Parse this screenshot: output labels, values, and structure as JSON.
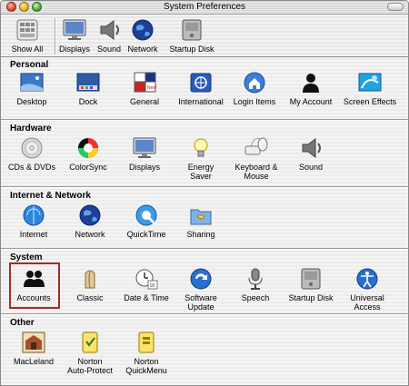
{
  "window": {
    "title": "System Preferences"
  },
  "toolbar": {
    "items": [
      {
        "label": "Show All",
        "icon": "show-all-icon"
      },
      {
        "label": "Displays",
        "icon": "display-icon"
      },
      {
        "label": "Sound",
        "icon": "speaker-icon"
      },
      {
        "label": "Network",
        "icon": "globe-icon"
      },
      {
        "label": "Startup Disk",
        "icon": "hard-disk-icon"
      }
    ]
  },
  "sections": [
    {
      "title": "Personal",
      "items": [
        {
          "label": "Desktop"
        },
        {
          "label": "Dock"
        },
        {
          "label": "General"
        },
        {
          "label": "International"
        },
        {
          "label": "Login Items"
        },
        {
          "label": "My Account"
        },
        {
          "label": "Screen Effects"
        }
      ]
    },
    {
      "title": "Hardware",
      "items": [
        {
          "label": "CDs & DVDs"
        },
        {
          "label": "ColorSync"
        },
        {
          "label": "Displays"
        },
        {
          "label": "Energy",
          "label2": "Saver"
        },
        {
          "label": "Keyboard &",
          "label2": "Mouse"
        },
        {
          "label": "Sound"
        }
      ]
    },
    {
      "title": "Internet & Network",
      "items": [
        {
          "label": "Internet"
        },
        {
          "label": "Network"
        },
        {
          "label": "QuickTime"
        },
        {
          "label": "Sharing"
        }
      ]
    },
    {
      "title": "System",
      "items": [
        {
          "label": "Accounts"
        },
        {
          "label": "Classic"
        },
        {
          "label": "Date & Time"
        },
        {
          "label": "Software",
          "label2": "Update"
        },
        {
          "label": "Speech"
        },
        {
          "label": "Startup Disk"
        },
        {
          "label": "Universal",
          "label2": "Access"
        }
      ]
    },
    {
      "title": "Other",
      "items": [
        {
          "label": "MacLeland"
        },
        {
          "label": "Norton",
          "label2": "Auto-Protect"
        },
        {
          "label": "Norton",
          "label2": "QuickMenu"
        }
      ]
    }
  ]
}
